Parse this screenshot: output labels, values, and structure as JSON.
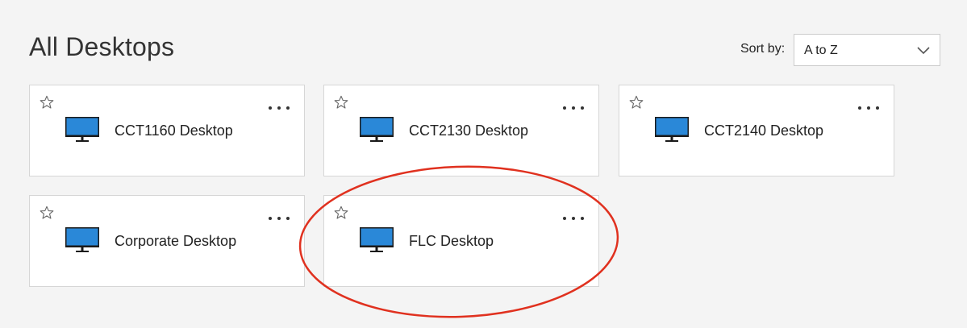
{
  "header": {
    "title": "All Desktops",
    "sort_label": "Sort by:",
    "sort_value": "A to Z"
  },
  "desktops": [
    {
      "label": "CCT1160 Desktop",
      "icon": "monitor-icon",
      "favorite": false
    },
    {
      "label": "CCT2130 Desktop",
      "icon": "monitor-icon",
      "favorite": false
    },
    {
      "label": "CCT2140 Desktop",
      "icon": "monitor-icon",
      "favorite": false
    },
    {
      "label": "Corporate Desktop",
      "icon": "monitor-icon",
      "favorite": false
    },
    {
      "label": "FLC Desktop",
      "icon": "monitor-icon",
      "favorite": false
    }
  ],
  "annotation": {
    "highlighted_item": "FLC Desktop",
    "color": "#e0311f"
  },
  "colors": {
    "background": "#f4f4f4",
    "tile_border": "#d6d6d6",
    "monitor_screen": "#2a88d8",
    "monitor_frame": "#1a1a1a"
  }
}
